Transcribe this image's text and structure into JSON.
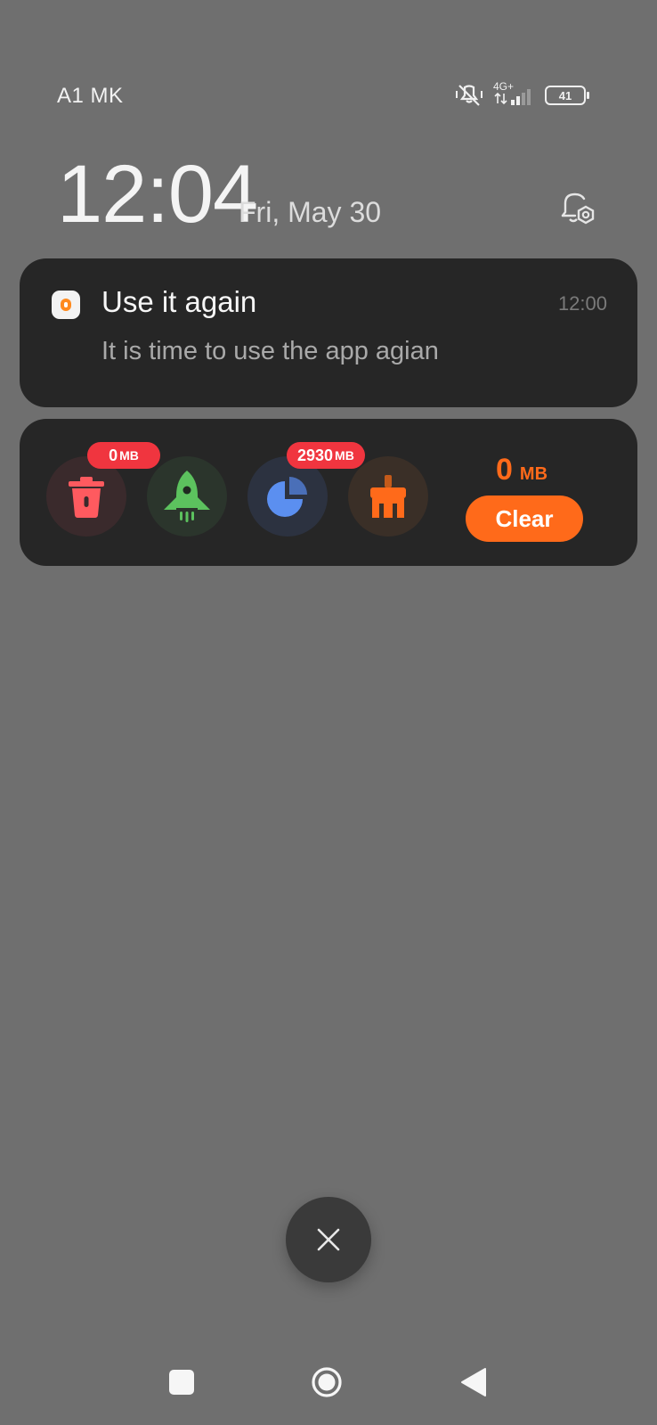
{
  "status_bar": {
    "carrier": "A1 MK",
    "network": "4G+",
    "battery": "41",
    "icons": [
      "vibrate-silent-icon",
      "signal-icon",
      "battery-icon"
    ]
  },
  "lockscreen": {
    "time": "12:04",
    "date": "Fri, May 30",
    "settings_icon": "bell-settings-icon"
  },
  "notification": {
    "app_icon": "app-icon",
    "title": "Use it again",
    "time": "12:00",
    "body": "It is time to use the app agian"
  },
  "cleaner": {
    "tools": [
      {
        "icon": "trash-icon",
        "badge_value": "0",
        "badge_unit": "MB",
        "color": "#ff5a5f"
      },
      {
        "icon": "rocket-icon",
        "color": "#5cc25e"
      },
      {
        "icon": "pie-chart-icon",
        "badge_value": "2930",
        "badge_unit": "MB",
        "color": "#5b8ff0"
      },
      {
        "icon": "broom-icon",
        "color": "#ff6a1a"
      }
    ],
    "total_value": "0",
    "total_unit": "MB",
    "clear_label": "Clear",
    "accent": "#ff6a1a",
    "badge_color": "#f0353f"
  },
  "dismiss_icon": "close-icon",
  "nav": {
    "recents_icon": "square-icon",
    "home_icon": "circle-icon",
    "back_icon": "triangle-back-icon"
  }
}
